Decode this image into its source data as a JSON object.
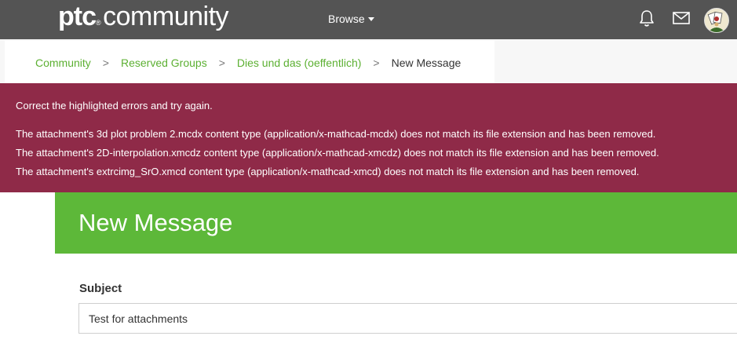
{
  "header": {
    "logo_brand": "ptc",
    "logo_reg": "®",
    "logo_text": "community",
    "browse_label": "Browse",
    "icons": [
      "bell-icon",
      "mail-icon",
      "avatar"
    ]
  },
  "breadcrumb": {
    "items": [
      "Community",
      "Reserved Groups",
      "Dies und das (oeffentlich)"
    ],
    "separator": ">",
    "current": "New Message"
  },
  "errors": {
    "summary": "Correct the highlighted errors and try again.",
    "messages": [
      "The attachment's 3d plot problem 2.mcdx content type (application/x-mathcad-mcdx) does not match its file extension and has been removed.",
      "The attachment's 2D-interpolation.xmcdz content type (application/x-mathcad-xmcdz) does not match its file extension and has been removed.",
      "The attachment's extrcimg_SrO.xmcd content type (application/x-mathcad-xmcd) does not match its file extension and has been removed."
    ]
  },
  "page": {
    "title": "New Message"
  },
  "form": {
    "subject_label": "Subject",
    "subject_value": "Test for attachments"
  },
  "colors": {
    "header_bg": "#545454",
    "link_green": "#5cb032",
    "error_bg": "#8f2a48",
    "banner_green": "#5db839"
  }
}
